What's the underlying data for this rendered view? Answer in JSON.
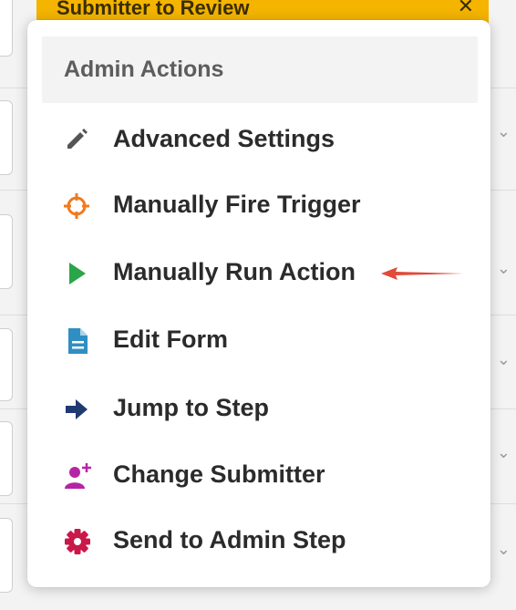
{
  "banner": {
    "title": "Submitter to Review",
    "close_glyph": "✕"
  },
  "menu": {
    "header": "Admin Actions",
    "items": [
      {
        "label": "Advanced Settings",
        "icon": "pencil-icon",
        "color": "#555555"
      },
      {
        "label": "Manually Fire Trigger",
        "icon": "crosshair-icon",
        "color": "#f07a1e"
      },
      {
        "label": "Manually Run Action",
        "icon": "play-icon",
        "color": "#2aa549"
      },
      {
        "label": "Edit Form",
        "icon": "document-icon",
        "color": "#2f8fc3"
      },
      {
        "label": "Jump to Step",
        "icon": "arrow-right-icon",
        "color": "#1f3a70"
      },
      {
        "label": "Change Submitter",
        "icon": "user-plus-icon",
        "color": "#b624a6"
      },
      {
        "label": "Send to Admin Step",
        "icon": "gear-icon",
        "color": "#c9184a"
      }
    ]
  },
  "annotation": {
    "color": "#e04b3a"
  }
}
